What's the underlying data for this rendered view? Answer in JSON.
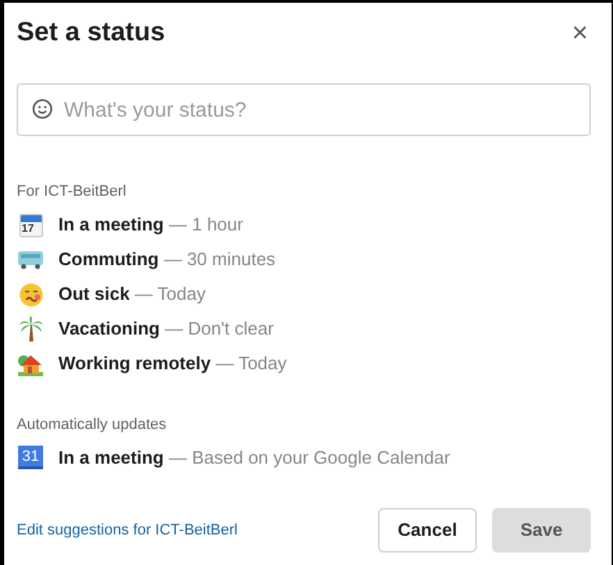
{
  "dialog": {
    "title": "Set a status",
    "close": "×"
  },
  "status_field": {
    "placeholder": "What's your status?"
  },
  "suggestions": {
    "heading": "For ICT-BeitBerl",
    "items": [
      {
        "kind": "calendar",
        "icon_text": "17",
        "label": "In a meeting",
        "detail": "— 1 hour"
      },
      {
        "kind": "bus",
        "label": "Commuting",
        "detail": "— 30 minutes"
      },
      {
        "kind": "sick",
        "label": "Out sick",
        "detail": "— Today"
      },
      {
        "kind": "palm",
        "label": "Vacationing",
        "detail": "— Don't clear"
      },
      {
        "kind": "house",
        "label": "Working remotely",
        "detail": "— Today"
      }
    ]
  },
  "automatic": {
    "heading": "Automatically updates",
    "items": [
      {
        "kind": "google-calendar",
        "icon_text": "31",
        "label": "In a meeting",
        "detail": "— Based on your Google Calendar"
      }
    ]
  },
  "footer": {
    "link": "Edit suggestions for ICT-BeitBerl",
    "buttons": [
      {
        "label": "Cancel",
        "disabled": false
      },
      {
        "label": "Save",
        "disabled": true
      }
    ]
  }
}
